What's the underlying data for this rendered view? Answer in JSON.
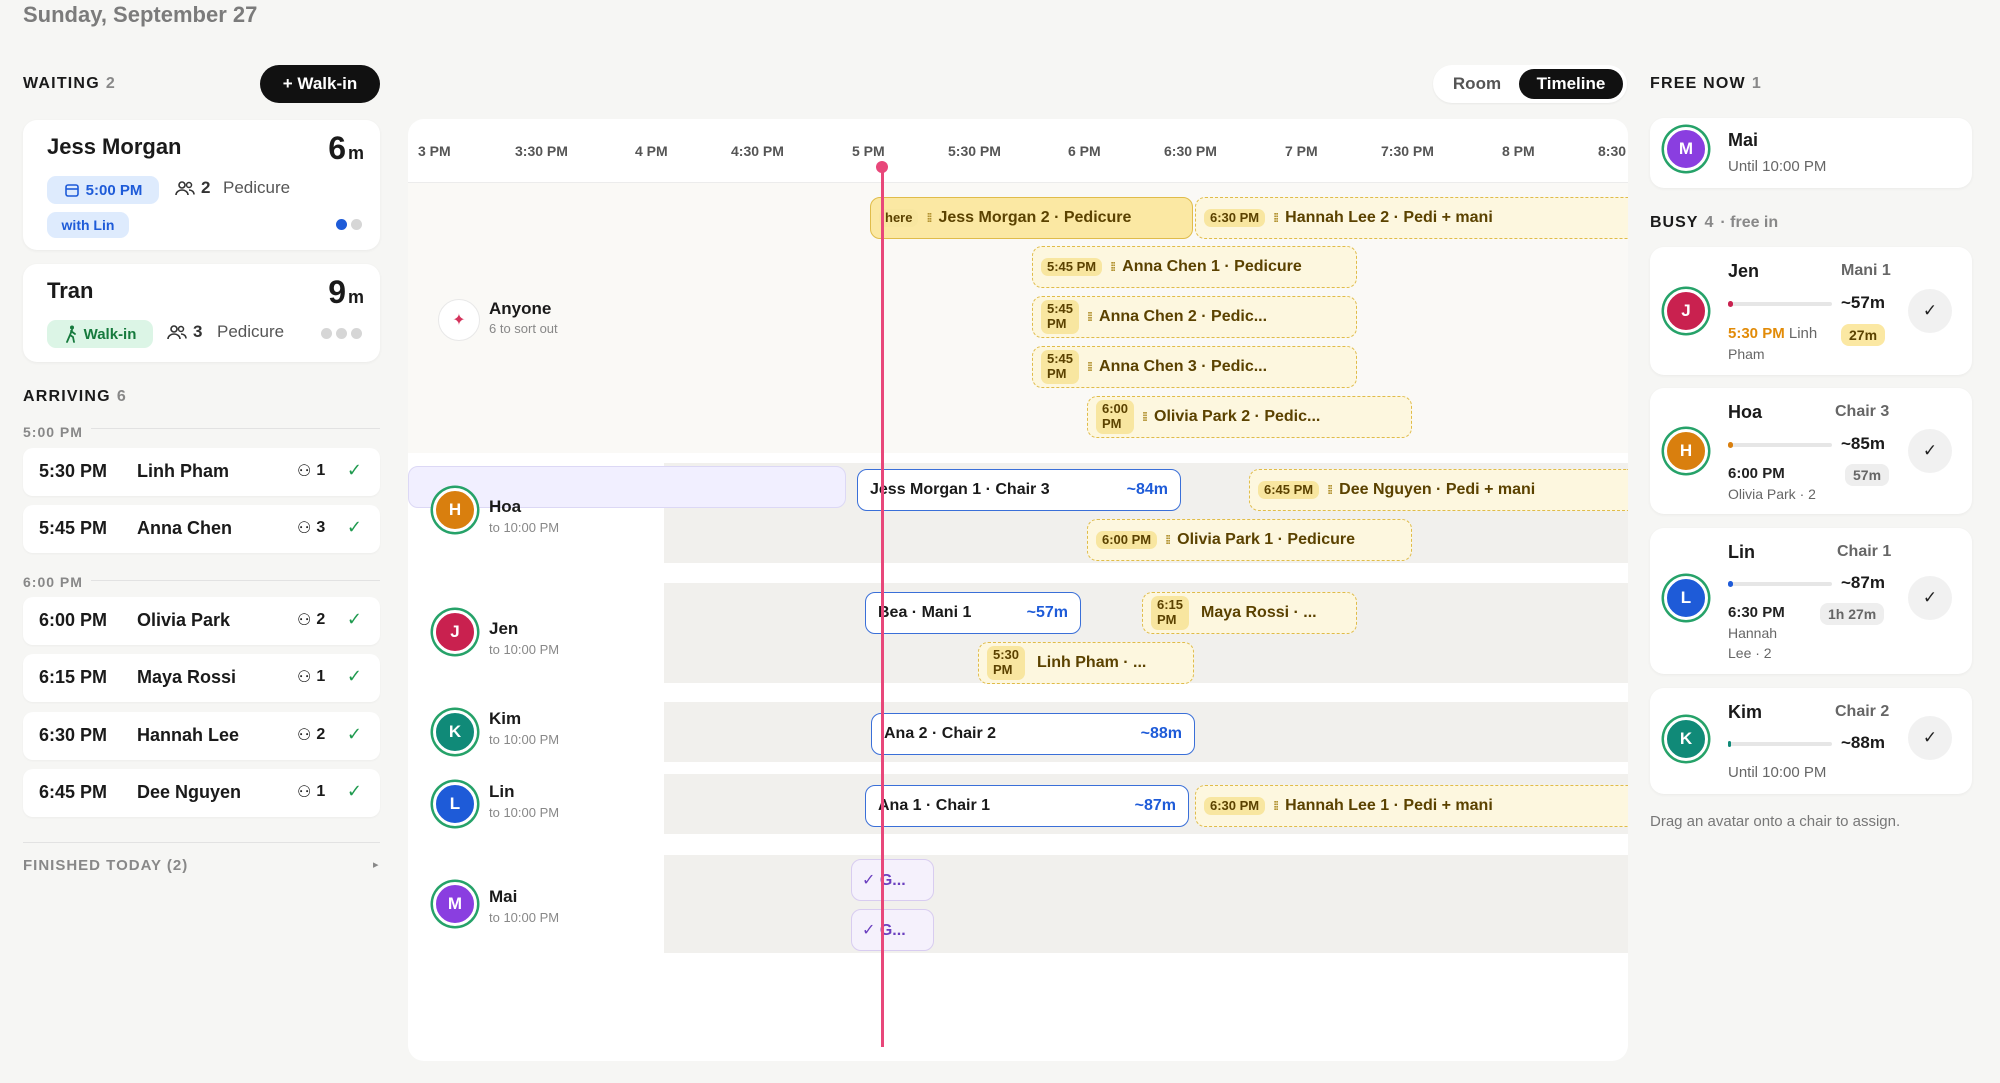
{
  "date": "Sunday, September 27",
  "waiting": {
    "title": "WAITING",
    "count": "2",
    "walkin_label": "+ Walk-in",
    "cards": [
      {
        "name": "Jess Morgan",
        "wait": "6",
        "unit": "m",
        "time": "5:00 PM",
        "party": "2",
        "service": "Pedicure",
        "tag": "with Lin"
      },
      {
        "name": "Tran",
        "wait": "9",
        "unit": "m",
        "type": "Walk-in",
        "party": "3",
        "service": "Pedicure"
      }
    ]
  },
  "arriving": {
    "title": "ARRIVING",
    "count": "6",
    "groups": [
      {
        "label": "5:00 PM",
        "rows": [
          {
            "time": "5:30 PM",
            "name": "Linh Pham",
            "party": "1"
          },
          {
            "time": "5:45 PM",
            "name": "Anna Chen",
            "party": "3"
          }
        ]
      },
      {
        "label": "6:00 PM",
        "rows": [
          {
            "time": "6:00 PM",
            "name": "Olivia Park",
            "party": "2"
          },
          {
            "time": "6:15 PM",
            "name": "Maya Rossi",
            "party": "1"
          },
          {
            "time": "6:30 PM",
            "name": "Hannah Lee",
            "party": "2"
          },
          {
            "time": "6:45 PM",
            "name": "Dee Nguyen",
            "party": "1"
          }
        ]
      }
    ]
  },
  "finished": {
    "label": "FINISHED TODAY (2)"
  },
  "view_toggle": {
    "room": "Room",
    "timeline": "Timeline"
  },
  "timeline": {
    "ticks": [
      "3 PM",
      "3:30 PM",
      "4 PM",
      "4:30 PM",
      "5 PM",
      "5:30 PM",
      "6 PM",
      "6:30 PM",
      "7 PM",
      "7:30 PM",
      "8 PM",
      "8:30"
    ],
    "anyone": {
      "name": "Anyone",
      "sub": "6 to sort out"
    },
    "lanes": [
      {
        "name": "Hoa",
        "sub": "to 10:00 PM",
        "initial": "H",
        "color": "#d97f0e"
      },
      {
        "name": "Jen",
        "sub": "to 10:00 PM",
        "initial": "J",
        "color": "#c9214f"
      },
      {
        "name": "Kim",
        "sub": "to 10:00 PM",
        "initial": "K",
        "color": "#108a78"
      },
      {
        "name": "Lin",
        "sub": "to 10:00 PM",
        "initial": "L",
        "color": "#1e5bd8"
      },
      {
        "name": "Mai",
        "sub": "to 10:00 PM",
        "initial": "M",
        "color": "#8a3ee0"
      }
    ],
    "blocks": {
      "b1": {
        "time": "here",
        "label": "Jess Morgan 2 · Pedicure"
      },
      "b2": {
        "time": "6:30 PM",
        "label": "Hannah Lee 2 · Pedi + mani"
      },
      "b3": {
        "time": "5:45 PM",
        "label": "Anna Chen 1 · Pedicure"
      },
      "b4": {
        "time1": "5:45",
        "time2": "PM",
        "label": "Anna Chen 2 · Pedic..."
      },
      "b5": {
        "time1": "5:45",
        "time2": "PM",
        "label": "Anna Chen 3 · Pedic..."
      },
      "b6": {
        "time1": "6:00",
        "time2": "PM",
        "label": "Olivia Park 2 · Pedic..."
      },
      "b7": {
        "label": "Jess Morgan 1 · Chair 3",
        "dur": "~84m"
      },
      "b8": {
        "time": "6:45 PM",
        "label": "Dee Nguyen · Pedi + mani"
      },
      "b9": {
        "time": "6:00 PM",
        "label": "Olivia Park 1 · Pedicure"
      },
      "b10": {
        "label": "Bea · Mani 1",
        "dur": "~57m"
      },
      "b11": {
        "time1": "6:15",
        "time2": "PM",
        "label": "Maya Rossi · ..."
      },
      "b12": {
        "time1": "5:30",
        "time2": "PM",
        "label": "Linh Pham · ..."
      },
      "b13": {
        "label": "Ana 2 · Chair 2",
        "dur": "~88m"
      },
      "b14": {
        "label": "Ana 1 · Chair 1",
        "dur": "~87m"
      },
      "b15": {
        "time": "6:30 PM",
        "label": "Hannah Lee 1 · Pedi + mani"
      },
      "b16": {
        "label": "✓ G..."
      },
      "b17": {
        "label": "✓ G..."
      }
    }
  },
  "free_now": {
    "title": "FREE NOW",
    "count": "1",
    "staff": {
      "name": "Mai",
      "sub": "Until 10:00 PM",
      "initial": "M",
      "color": "#8a3ee0"
    }
  },
  "busy": {
    "title": "BUSY",
    "count": "4",
    "suffix": "· free in",
    "staff": [
      {
        "name": "Jen",
        "chair": "Mani 1",
        "dur": "~57m",
        "initial": "J",
        "color": "#c9214f",
        "next_time": "5:30 PM",
        "next_name": "Linh",
        "next_name2": "Pham",
        "pill": "27m",
        "bar_color": "#c9214f"
      },
      {
        "name": "Hoa",
        "chair": "Chair 3",
        "dur": "~85m",
        "initial": "H",
        "color": "#d97f0e",
        "next_time": "6:00 PM",
        "next_sub": "Olivia Park · 2",
        "pill": "57m",
        "bar_color": "#d97f0e"
      },
      {
        "name": "Lin",
        "chair": "Chair 1",
        "dur": "~87m",
        "initial": "L",
        "color": "#1e5bd8",
        "next_time": "6:30 PM",
        "next_sub1": "Hannah",
        "next_sub2": "Lee · 2",
        "pill": "1h 27m",
        "bar_color": "#1e5bd8"
      },
      {
        "name": "Kim",
        "chair": "Chair 2",
        "dur": "~88m",
        "initial": "K",
        "color": "#108a78",
        "next_sub": "Until 10:00 PM",
        "bar_color": "#108a78"
      }
    ]
  },
  "hint": "Drag an avatar onto a chair to assign."
}
